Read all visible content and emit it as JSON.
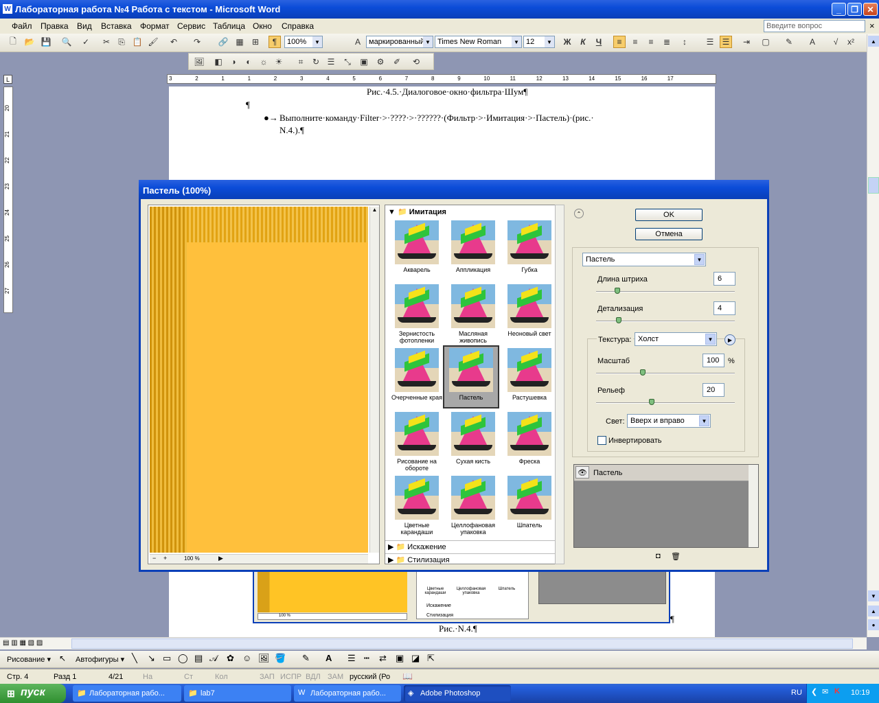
{
  "window": {
    "title": "Лабораторная работа №4 Работа с текстом - Microsoft Word",
    "min": "_",
    "max": "❐",
    "close": "✕"
  },
  "menu": {
    "items": [
      "Файл",
      "Правка",
      "Вид",
      "Вставка",
      "Формат",
      "Сервис",
      "Таблица",
      "Окно",
      "Справка"
    ],
    "help_placeholder": "Введите вопрос",
    "close_doc": "×"
  },
  "toolbar": {
    "zoom": "100%",
    "style": "маркированный",
    "font": "Times New Roman",
    "size": "12",
    "bold": "Ж",
    "italic": "К",
    "underline": "Ч"
  },
  "ruler_marks": [
    "3",
    "2",
    "1",
    "1",
    "2",
    "3",
    "4",
    "5",
    "6",
    "7",
    "8",
    "9",
    "10",
    "11",
    "12",
    "13",
    "14",
    "15",
    "16",
    "17"
  ],
  "vruler_marks": [
    "20",
    "21",
    "22",
    "23",
    "24",
    "25",
    "26",
    "27"
  ],
  "document": {
    "caption1": "Рис.·4.5.·Диалоговое·окно·фильтра·Шум¶",
    "para_mark": "¶",
    "bullet": "●→",
    "instruction1": "Выполните·команду·Filter·>·????·>·??????·(Фильтр·>·Имитация·>·Пастель)·(рис.·",
    "instruction2": "N.4.).¶",
    "caption2": "Рис.·N.4.¶",
    "end_mark": "¶"
  },
  "dialog": {
    "title": "Пастель (100%)",
    "ok": "OK",
    "cancel": "Отмена",
    "preview_zoom": "100 %",
    "zoom_minus": "−",
    "zoom_plus": "+",
    "category_open": "Имитация",
    "categories_closed": [
      "Искажение",
      "Стилизация"
    ],
    "filters": [
      {
        "label": "Акварель"
      },
      {
        "label": "Аппликация"
      },
      {
        "label": "Губка"
      },
      {
        "label": "Зернистость фотопленки"
      },
      {
        "label": "Масляная живопись"
      },
      {
        "label": "Неоновый свет"
      },
      {
        "label": "Очерченные края"
      },
      {
        "label": "Пастель"
      },
      {
        "label": "Растушевка"
      },
      {
        "label": "Рисование на обороте"
      },
      {
        "label": "Сухая кисть"
      },
      {
        "label": "Фреска"
      },
      {
        "label": "Цветные карандаши"
      },
      {
        "label": "Целлофановая упаковка"
      },
      {
        "label": "Шпатель"
      }
    ],
    "filter_select": "Пастель",
    "stroke_length_label": "Длина штриха",
    "stroke_length": "6",
    "detail_label": "Детализация",
    "detail": "4",
    "texture_label": "Текстура:",
    "texture": "Холст",
    "scale_label": "Масштаб",
    "scale": "100",
    "scale_unit": "%",
    "relief_label": "Рельеф",
    "relief": "20",
    "light_label": "Свет:",
    "light": "Вверх и вправо",
    "invert_label": "Инвертировать",
    "layer_name": "Пастель"
  },
  "bg_thumbs": [
    "Цветные карандаши",
    "Целлофановая упаковка",
    "Шпатель"
  ],
  "bg_zoom": "100 %",
  "bg_cats": [
    "Искажение",
    "Стилизация"
  ],
  "drawbar": {
    "draw": "Рисование ▾",
    "autoshapes": "Автофигуры ▾"
  },
  "status": {
    "page": "Стр.  4",
    "section": "Разд  1",
    "pages": "4/21",
    "at": "На",
    "line": "Ст",
    "col": "Кол",
    "rec": "ЗАП",
    "trk": "ИСПР",
    "ext": "ВДЛ",
    "ovr": "ЗАМ",
    "lang": "русский (Ро"
  },
  "taskbar": {
    "start": "пуск",
    "tasks": [
      "Лабораторная рабо...",
      "lab7",
      "Лабораторная рабо...",
      "Adobe Photoshop"
    ],
    "lang": "RU",
    "time": "10:19"
  }
}
